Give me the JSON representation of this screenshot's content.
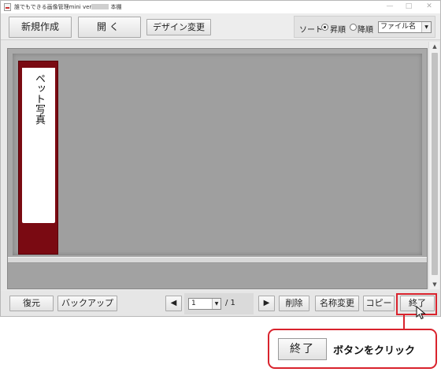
{
  "window": {
    "title_prefix": "誰でもできる画像管理mini ver",
    "title_suffix": " 本棚",
    "minimize_glyph": "—",
    "maximize_glyph": "□",
    "close_glyph": "✕"
  },
  "toolbar": {
    "new_label": "新規作成",
    "open_label": "開く",
    "design_label": "デザイン変更",
    "sort": {
      "label": "ソート",
      "ascending_label": "昇順",
      "descending_label": "降順",
      "selected_order": "昇順",
      "field_value": "ファイル名",
      "dropdown_glyph": "▼"
    }
  },
  "shelf": {
    "albums": [
      {
        "title": "ペット写真",
        "color": "#7a0a12"
      }
    ],
    "scroll_up_glyph": "▲",
    "scroll_down_glyph": "▼"
  },
  "bottombar": {
    "restore_label": "復元",
    "backup_label": "バックアップ",
    "prev_glyph": "◀",
    "next_glyph": "▶",
    "current_page": "1",
    "page_dropdown_glyph": "▼",
    "total_pages": "/ 1",
    "delete_label": "削除",
    "rename_label": "名称変更",
    "copy_label": "コピー",
    "exit_label": "終了"
  },
  "callout": {
    "button_label": "終了",
    "text": "ボタンをクリック",
    "accent_color": "#d9232d"
  }
}
